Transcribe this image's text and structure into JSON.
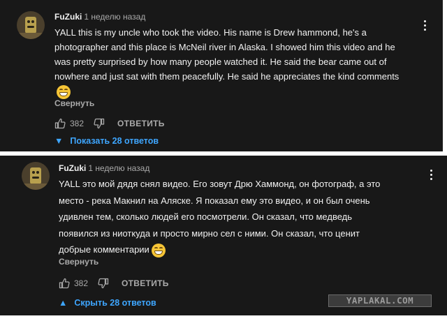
{
  "comments": [
    {
      "author": "FuZuki",
      "time": "1 неделю назад",
      "text": "YALL this is my uncle who took the video. His name is Drew hammond, he's a photographer and this place is McNeil river in Alaska. I showed him this video and he was pretty surprised by how many people watched it. He said the bear came out of nowhere and just sat with them peacefully. He said he appreciates the kind comments",
      "collapse_label": "Свернуть",
      "likes": "382",
      "reply_label": "ОТВЕТИТЬ",
      "replies_label": "Показать 28 ответов",
      "replies_caret": "▼"
    },
    {
      "author": "FuZuki",
      "time": "1 неделю назад",
      "text": "YALL это мой дядя снял видео. Его зовут Дрю Хаммонд, он фотограф, а это место - река Макнил на Аляске. Я показал ему это видео, и он был очень удивлен тем, сколько людей его посмотрели. Он сказал, что медведь появился из ниоткуда и просто мирно сел с ними. Он сказал, что ценит добрые комментарии",
      "collapse_label": "Свернуть",
      "likes": "382",
      "reply_label": "ОТВЕТИТЬ",
      "replies_label": "Скрыть 28 ответов",
      "replies_caret": "▲"
    }
  ],
  "watermark": "YAPLAKAL.COM",
  "icons": [
    "thumb-up-icon",
    "thumb-down-icon",
    "more-vert-icon",
    "grinning-emoji-icon"
  ],
  "colors": {
    "background": "#181818",
    "text": "#f1f1f1",
    "secondary_text": "#aaaaaa",
    "link_blue": "#3ea6ff"
  }
}
